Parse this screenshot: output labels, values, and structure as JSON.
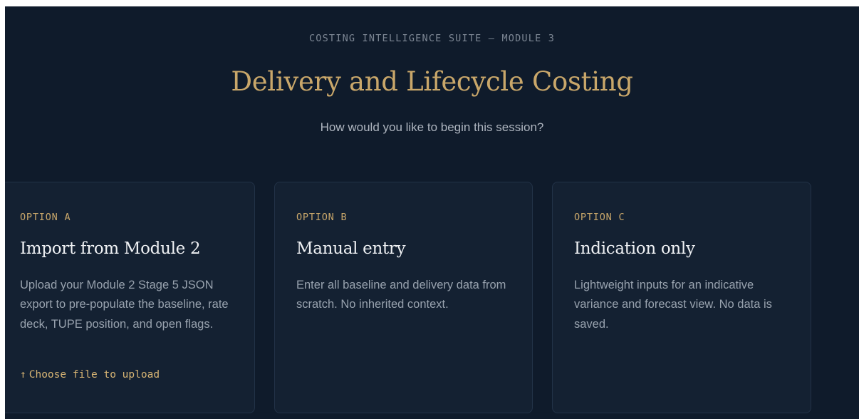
{
  "header": {
    "eyebrow": "COSTING INTELLIGENCE SUITE — MODULE 3",
    "title": "Delivery and Lifecycle Costing",
    "subtitle": "How would you like to begin this session?"
  },
  "options": [
    {
      "tag": "OPTION A",
      "title": "Import from Module 2",
      "description": "Upload your Module 2 Stage 5 JSON export to pre-populate the baseline, rate deck, TUPE position, and open flags.",
      "upload_label": "Choose file to upload",
      "upload_icon": "↑"
    },
    {
      "tag": "OPTION B",
      "title": "Manual entry",
      "description": "Enter all baseline and delivery data from scratch. No inherited context."
    },
    {
      "tag": "OPTION C",
      "title": "Indication only",
      "description": "Lightweight inputs for an indicative variance and forecast view. No data is saved."
    }
  ],
  "colors": {
    "background": "#0f1b2b",
    "card": "#142132",
    "accent_gold": "#c9a76a",
    "text_primary": "#eef0f3",
    "text_muted": "#98a2ae"
  }
}
